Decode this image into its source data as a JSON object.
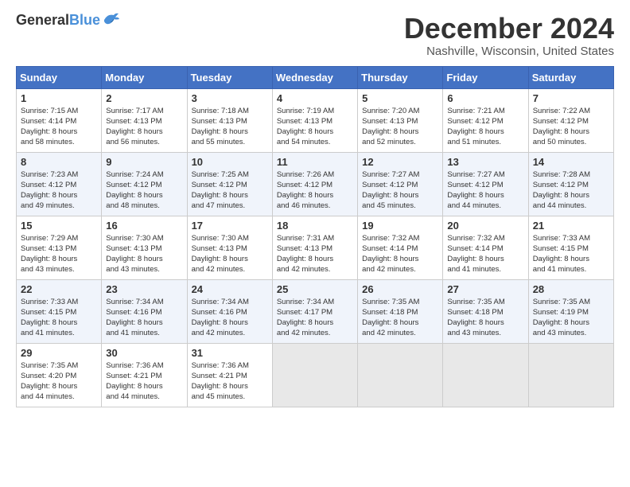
{
  "header": {
    "logo_line1": "General",
    "logo_line2": "Blue",
    "month_title": "December 2024",
    "location": "Nashville, Wisconsin, United States"
  },
  "days_of_week": [
    "Sunday",
    "Monday",
    "Tuesday",
    "Wednesday",
    "Thursday",
    "Friday",
    "Saturday"
  ],
  "weeks": [
    [
      {
        "day": "1",
        "info": "Sunrise: 7:15 AM\nSunset: 4:14 PM\nDaylight: 8 hours\nand 58 minutes."
      },
      {
        "day": "2",
        "info": "Sunrise: 7:17 AM\nSunset: 4:13 PM\nDaylight: 8 hours\nand 56 minutes."
      },
      {
        "day": "3",
        "info": "Sunrise: 7:18 AM\nSunset: 4:13 PM\nDaylight: 8 hours\nand 55 minutes."
      },
      {
        "day": "4",
        "info": "Sunrise: 7:19 AM\nSunset: 4:13 PM\nDaylight: 8 hours\nand 54 minutes."
      },
      {
        "day": "5",
        "info": "Sunrise: 7:20 AM\nSunset: 4:13 PM\nDaylight: 8 hours\nand 52 minutes."
      },
      {
        "day": "6",
        "info": "Sunrise: 7:21 AM\nSunset: 4:12 PM\nDaylight: 8 hours\nand 51 minutes."
      },
      {
        "day": "7",
        "info": "Sunrise: 7:22 AM\nSunset: 4:12 PM\nDaylight: 8 hours\nand 50 minutes."
      }
    ],
    [
      {
        "day": "8",
        "info": "Sunrise: 7:23 AM\nSunset: 4:12 PM\nDaylight: 8 hours\nand 49 minutes."
      },
      {
        "day": "9",
        "info": "Sunrise: 7:24 AM\nSunset: 4:12 PM\nDaylight: 8 hours\nand 48 minutes."
      },
      {
        "day": "10",
        "info": "Sunrise: 7:25 AM\nSunset: 4:12 PM\nDaylight: 8 hours\nand 47 minutes."
      },
      {
        "day": "11",
        "info": "Sunrise: 7:26 AM\nSunset: 4:12 PM\nDaylight: 8 hours\nand 46 minutes."
      },
      {
        "day": "12",
        "info": "Sunrise: 7:27 AM\nSunset: 4:12 PM\nDaylight: 8 hours\nand 45 minutes."
      },
      {
        "day": "13",
        "info": "Sunrise: 7:27 AM\nSunset: 4:12 PM\nDaylight: 8 hours\nand 44 minutes."
      },
      {
        "day": "14",
        "info": "Sunrise: 7:28 AM\nSunset: 4:12 PM\nDaylight: 8 hours\nand 44 minutes."
      }
    ],
    [
      {
        "day": "15",
        "info": "Sunrise: 7:29 AM\nSunset: 4:13 PM\nDaylight: 8 hours\nand 43 minutes."
      },
      {
        "day": "16",
        "info": "Sunrise: 7:30 AM\nSunset: 4:13 PM\nDaylight: 8 hours\nand 43 minutes."
      },
      {
        "day": "17",
        "info": "Sunrise: 7:30 AM\nSunset: 4:13 PM\nDaylight: 8 hours\nand 42 minutes."
      },
      {
        "day": "18",
        "info": "Sunrise: 7:31 AM\nSunset: 4:13 PM\nDaylight: 8 hours\nand 42 minutes."
      },
      {
        "day": "19",
        "info": "Sunrise: 7:32 AM\nSunset: 4:14 PM\nDaylight: 8 hours\nand 42 minutes."
      },
      {
        "day": "20",
        "info": "Sunrise: 7:32 AM\nSunset: 4:14 PM\nDaylight: 8 hours\nand 41 minutes."
      },
      {
        "day": "21",
        "info": "Sunrise: 7:33 AM\nSunset: 4:15 PM\nDaylight: 8 hours\nand 41 minutes."
      }
    ],
    [
      {
        "day": "22",
        "info": "Sunrise: 7:33 AM\nSunset: 4:15 PM\nDaylight: 8 hours\nand 41 minutes."
      },
      {
        "day": "23",
        "info": "Sunrise: 7:34 AM\nSunset: 4:16 PM\nDaylight: 8 hours\nand 41 minutes."
      },
      {
        "day": "24",
        "info": "Sunrise: 7:34 AM\nSunset: 4:16 PM\nDaylight: 8 hours\nand 42 minutes."
      },
      {
        "day": "25",
        "info": "Sunrise: 7:34 AM\nSunset: 4:17 PM\nDaylight: 8 hours\nand 42 minutes."
      },
      {
        "day": "26",
        "info": "Sunrise: 7:35 AM\nSunset: 4:18 PM\nDaylight: 8 hours\nand 42 minutes."
      },
      {
        "day": "27",
        "info": "Sunrise: 7:35 AM\nSunset: 4:18 PM\nDaylight: 8 hours\nand 43 minutes."
      },
      {
        "day": "28",
        "info": "Sunrise: 7:35 AM\nSunset: 4:19 PM\nDaylight: 8 hours\nand 43 minutes."
      }
    ],
    [
      {
        "day": "29",
        "info": "Sunrise: 7:35 AM\nSunset: 4:20 PM\nDaylight: 8 hours\nand 44 minutes."
      },
      {
        "day": "30",
        "info": "Sunrise: 7:36 AM\nSunset: 4:21 PM\nDaylight: 8 hours\nand 44 minutes."
      },
      {
        "day": "31",
        "info": "Sunrise: 7:36 AM\nSunset: 4:21 PM\nDaylight: 8 hours\nand 45 minutes."
      },
      {
        "day": "",
        "info": ""
      },
      {
        "day": "",
        "info": ""
      },
      {
        "day": "",
        "info": ""
      },
      {
        "day": "",
        "info": ""
      }
    ]
  ]
}
